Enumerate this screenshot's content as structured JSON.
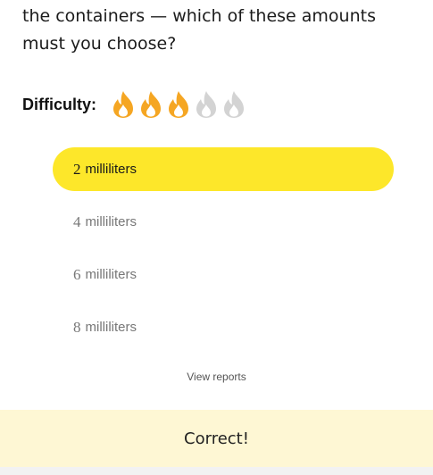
{
  "question": {
    "text": "the containers — which of these amounts must you choose?"
  },
  "difficulty": {
    "label": "Difficulty:",
    "level": 3,
    "max": 5,
    "active_color": "#f5a623",
    "inactive_color": "#d3d3d3"
  },
  "options": [
    {
      "number": "2",
      "unit": "milliliters",
      "selected": true
    },
    {
      "number": "4",
      "unit": "milliliters",
      "selected": false
    },
    {
      "number": "6",
      "unit": "milliliters",
      "selected": false
    },
    {
      "number": "8",
      "unit": "milliliters",
      "selected": false
    }
  ],
  "selection_color": "#fde72a",
  "links": {
    "view_reports": "View reports"
  },
  "feedback": {
    "text": "Correct!",
    "background": "#fef7d4"
  }
}
